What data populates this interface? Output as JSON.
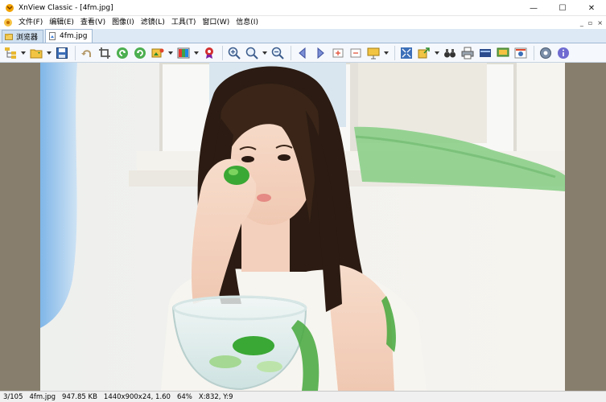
{
  "window": {
    "title": "XnView Classic - [4fm.jpg]",
    "minimize_symbol": "—",
    "maximize_symbol": "☐",
    "close_symbol": "✕"
  },
  "menu": {
    "items": [
      "文件(F)",
      "编辑(E)",
      "查看(V)",
      "图像(I)",
      "滤镜(L)",
      "工具(T)",
      "窗口(W)",
      "信息(I)"
    ],
    "mdi_minimize": "_",
    "mdi_restore": "▫",
    "mdi_close": "×"
  },
  "tabs": [
    {
      "label": "浏览器",
      "icon": "browser-icon",
      "active": false
    },
    {
      "label": "4fm.jpg",
      "icon": "image-file-icon",
      "active": true
    }
  ],
  "toolbar": {
    "buttons": [
      "folder-tree-icon",
      "open-folder-icon",
      "save-icon",
      "undo-icon",
      "crop-icon",
      "rotate-left-icon",
      "rotate-right-icon",
      "image-tools-icon",
      "color-adjust-icon",
      "effects-icon",
      "zoom-in-icon",
      "zoom-icon",
      "zoom-out-icon",
      "previous-icon",
      "next-icon",
      "first-icon",
      "last-icon",
      "slideshow-icon",
      "fullscreen-icon",
      "export-icon",
      "binoculars-icon",
      "print-icon",
      "scanner-icon",
      "desktop-icon",
      "capture-icon",
      "settings-icon",
      "info-icon"
    ]
  },
  "status": {
    "index": "3/105",
    "filename": "4fm.jpg",
    "filesize": "947.85 KB",
    "dimensions": "1440x900x24, 1.60",
    "zoom": "64%",
    "cursor": "X:832, Y:9"
  },
  "colors": {
    "viewer_background": "#877e6d",
    "tab_bar": "#dde9f5",
    "toolbar": "#f5f8fc",
    "photo_background": "#f0efe9",
    "hair": "#2b1b12",
    "lime": "#3aa835"
  }
}
